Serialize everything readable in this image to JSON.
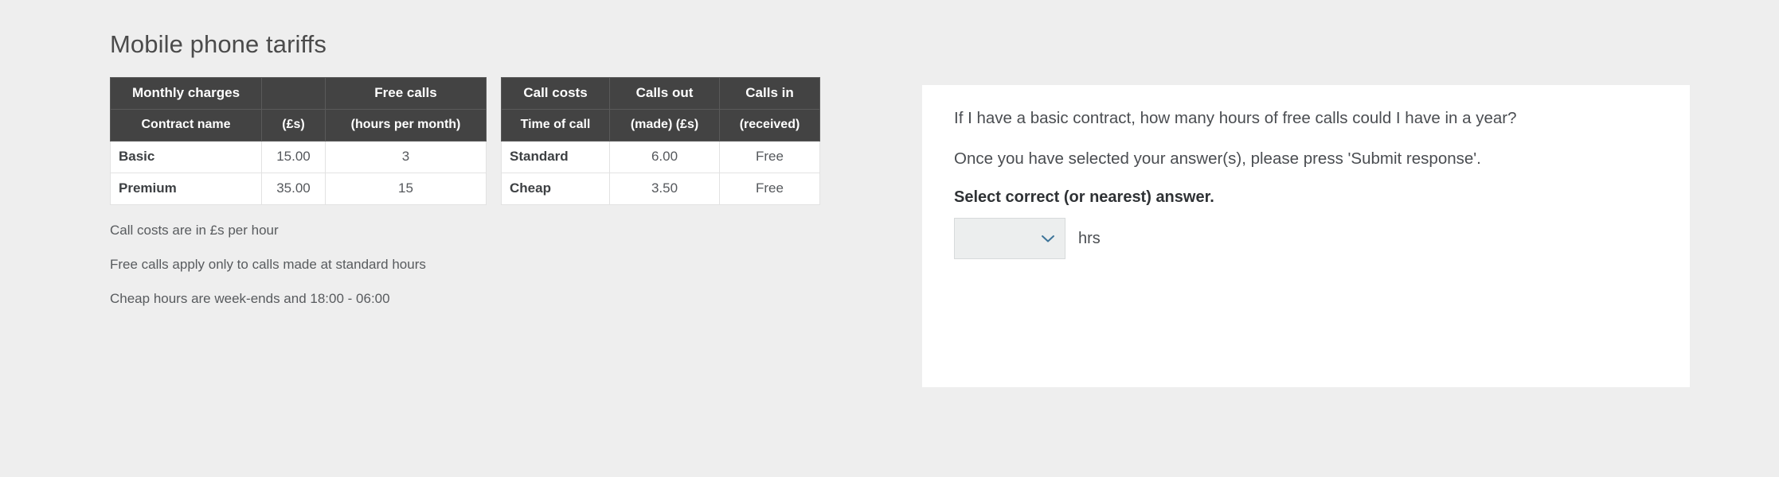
{
  "page": {
    "title": "Mobile phone tariffs",
    "background_color": "#eeeeee",
    "panel_color": "#ffffff",
    "header_color": "#434343",
    "accent_color": "#3d7499"
  },
  "tables": [
    {
      "id": "monthly-charges",
      "group_headers": [
        "Monthly charges",
        "",
        "Free calls"
      ],
      "columns": [
        "Contract name",
        "(£s)",
        "(hours per month)"
      ],
      "rows": [
        [
          "Basic",
          "15.00",
          "3"
        ],
        [
          "Premium",
          "35.00",
          "15"
        ]
      ]
    },
    {
      "id": "call-costs",
      "group_headers": [
        "Call costs",
        "Calls out",
        "Calls in"
      ],
      "columns": [
        "Time of call",
        "(made) (£s)",
        "(received)"
      ],
      "rows": [
        [
          "Standard",
          "6.00",
          "Free"
        ],
        [
          "Cheap",
          "3.50",
          "Free"
        ]
      ]
    }
  ],
  "footnotes": [
    "Call costs are in £s per hour",
    "Free calls apply only to calls made at standard hours",
    "Cheap hours are week-ends and 18:00 - 06:00"
  ],
  "question": {
    "prompt": "If I have a basic contract, how many hours of free calls could I have in a year?",
    "instruction": "Once you have selected your answer(s), please press 'Submit response'.",
    "select_label": "Select correct (or nearest) answer.",
    "answer_select": {
      "selected_value": "",
      "icon": "chevron-down-icon"
    },
    "unit": "hrs"
  }
}
